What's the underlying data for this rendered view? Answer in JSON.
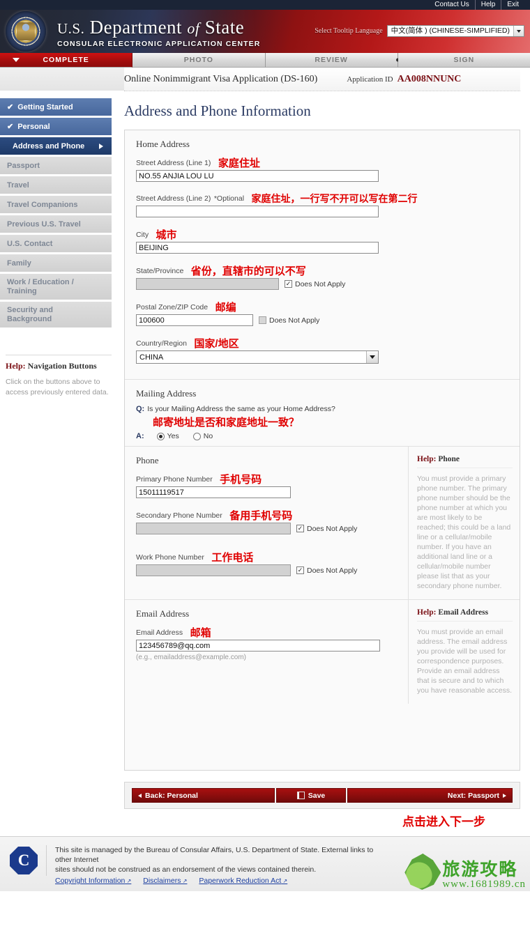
{
  "utility": {
    "links": [
      "Contact Us",
      "Help",
      "Exit"
    ]
  },
  "banner": {
    "title_us": "U.S.",
    "title_department": "Department",
    "title_of": "of",
    "title_state": "State",
    "subtitle": "CONSULAR ELECTRONIC APPLICATION CENTER",
    "lang_label": "Select Tooltip Language",
    "lang_value": "中文(简体 ) (CHINESE-SIMPLIFIED)"
  },
  "tabs": [
    {
      "label": "COMPLETE",
      "active": true
    },
    {
      "label": "PHOTO",
      "active": false
    },
    {
      "label": "REVIEW",
      "active": false
    },
    {
      "label": "SIGN",
      "active": false
    }
  ],
  "crumb": {
    "title": "Online Nonimmigrant Visa Application (DS-160)",
    "appid_label": "Application ID",
    "appid": "AA008NNUNC"
  },
  "page_title": "Address and Phone Information",
  "sidebar": {
    "items": [
      {
        "label": "Getting Started",
        "state": "done"
      },
      {
        "label": "Personal",
        "state": "done"
      },
      {
        "label": "Address and Phone",
        "state": "current"
      },
      {
        "label": "Passport",
        "state": "pending"
      },
      {
        "label": "Travel",
        "state": "pending"
      },
      {
        "label": "Travel Companions",
        "state": "pending"
      },
      {
        "label": "Previous U.S. Travel",
        "state": "pending"
      },
      {
        "label": "U.S. Contact",
        "state": "pending"
      },
      {
        "label": "Family",
        "state": "pending"
      },
      {
        "label": "Work / Education / Training",
        "state": "pending"
      },
      {
        "label": "Security and Background",
        "state": "pending"
      }
    ],
    "nav_item_work_line1": "Work / Education /",
    "nav_item_work_line2": "Training",
    "nav_item_security_line1": "Security and",
    "nav_item_security_line2": "Background",
    "help_title_prefix": "Help:",
    "help_title_rest": " Navigation Buttons",
    "help_body": "Click on the buttons above to access previously entered data."
  },
  "home_address": {
    "section_title": "Home Address",
    "street1_label": "Street Address (Line 1)",
    "street1_annotation": "家庭住址",
    "street1_value": "NO.55 ANJIA LOU LU",
    "street2_label": "Street Address (Line 2)",
    "street2_optional": "*Optional",
    "street2_annotation": "家庭住址，一行写不开可以写在第二行",
    "street2_value": "",
    "city_label": "City",
    "city_annotation": "城市",
    "city_value": "BEIJING",
    "state_label": "State/Province",
    "state_annotation": "省份，直辖市的可以不写",
    "state_value": "",
    "state_dna_label": "Does Not Apply",
    "state_dna_checked": true,
    "postal_label": "Postal Zone/ZIP Code",
    "postal_annotation": "邮编",
    "postal_value": "100600",
    "postal_dna_label": "Does Not Apply",
    "postal_dna_checked": false,
    "country_label": "Country/Region",
    "country_annotation": "国家/地区",
    "country_value": "CHINA"
  },
  "mailing_address": {
    "section_title": "Mailing Address",
    "q_mark": "Q:",
    "question": "Is your Mailing Address the same as your Home Address?",
    "annotation": "邮寄地址是否和家庭地址一致？",
    "a_mark": "A:",
    "option_yes": "Yes",
    "option_no": "No",
    "selected": "Yes"
  },
  "phone": {
    "section_title": "Phone",
    "primary_label": "Primary Phone Number",
    "primary_annotation": "手机号码",
    "primary_value": "15011119517",
    "secondary_label": "Secondary Phone Number",
    "secondary_annotation": "备用手机号码",
    "secondary_value": "",
    "secondary_dna_label": "Does Not Apply",
    "secondary_dna_checked": true,
    "work_label": "Work Phone Number",
    "work_annotation": "工作电话",
    "work_value": "",
    "work_dna_label": "Does Not Apply",
    "work_dna_checked": true,
    "help_title_prefix": "Help:",
    "help_title_rest": " Phone",
    "help_body": "You must provide a primary phone number. The primary phone number should be the phone number at which you are most likely to be reached; this could be a land line or a cellular/mobile number. If you have an additional land line or a cellular/mobile number please list that as your secondary phone number."
  },
  "email": {
    "section_title": "Email Address",
    "label": "Email Address",
    "annotation": "邮箱",
    "value": "123456789@qq.com",
    "hint": "(e.g., emailaddress@example.com)",
    "help_title_prefix": "Help:",
    "help_title_rest": " Email Address",
    "help_body": "You must provide an email address.  The email address you provide will be used for correspondence purposes.  Provide an email address that is secure and to which you have reasonable access."
  },
  "buttons": {
    "back": "Back: Personal",
    "save": "Save",
    "next": "Next: Passport",
    "next_annotation": "点击进入下一步"
  },
  "footer": {
    "seal_letter": "C",
    "text_line1": "This site is managed by the Bureau of Consular Affairs, U.S. Department of State. External links to other Internet",
    "text_line2": "sites should not be construed as an endorsement of the views contained therein.",
    "links": [
      "Copyright Information",
      "Disclaimers",
      "Paperwork Reduction Act"
    ]
  },
  "watermark": {
    "cn": "旅游攻略",
    "url": "www.1681989.cn"
  },
  "colors": {
    "brand_red": "#a81010",
    "annotation_red": "#e00000",
    "nav_blue": "#2c4c80",
    "title_blue": "#2b3b63"
  }
}
